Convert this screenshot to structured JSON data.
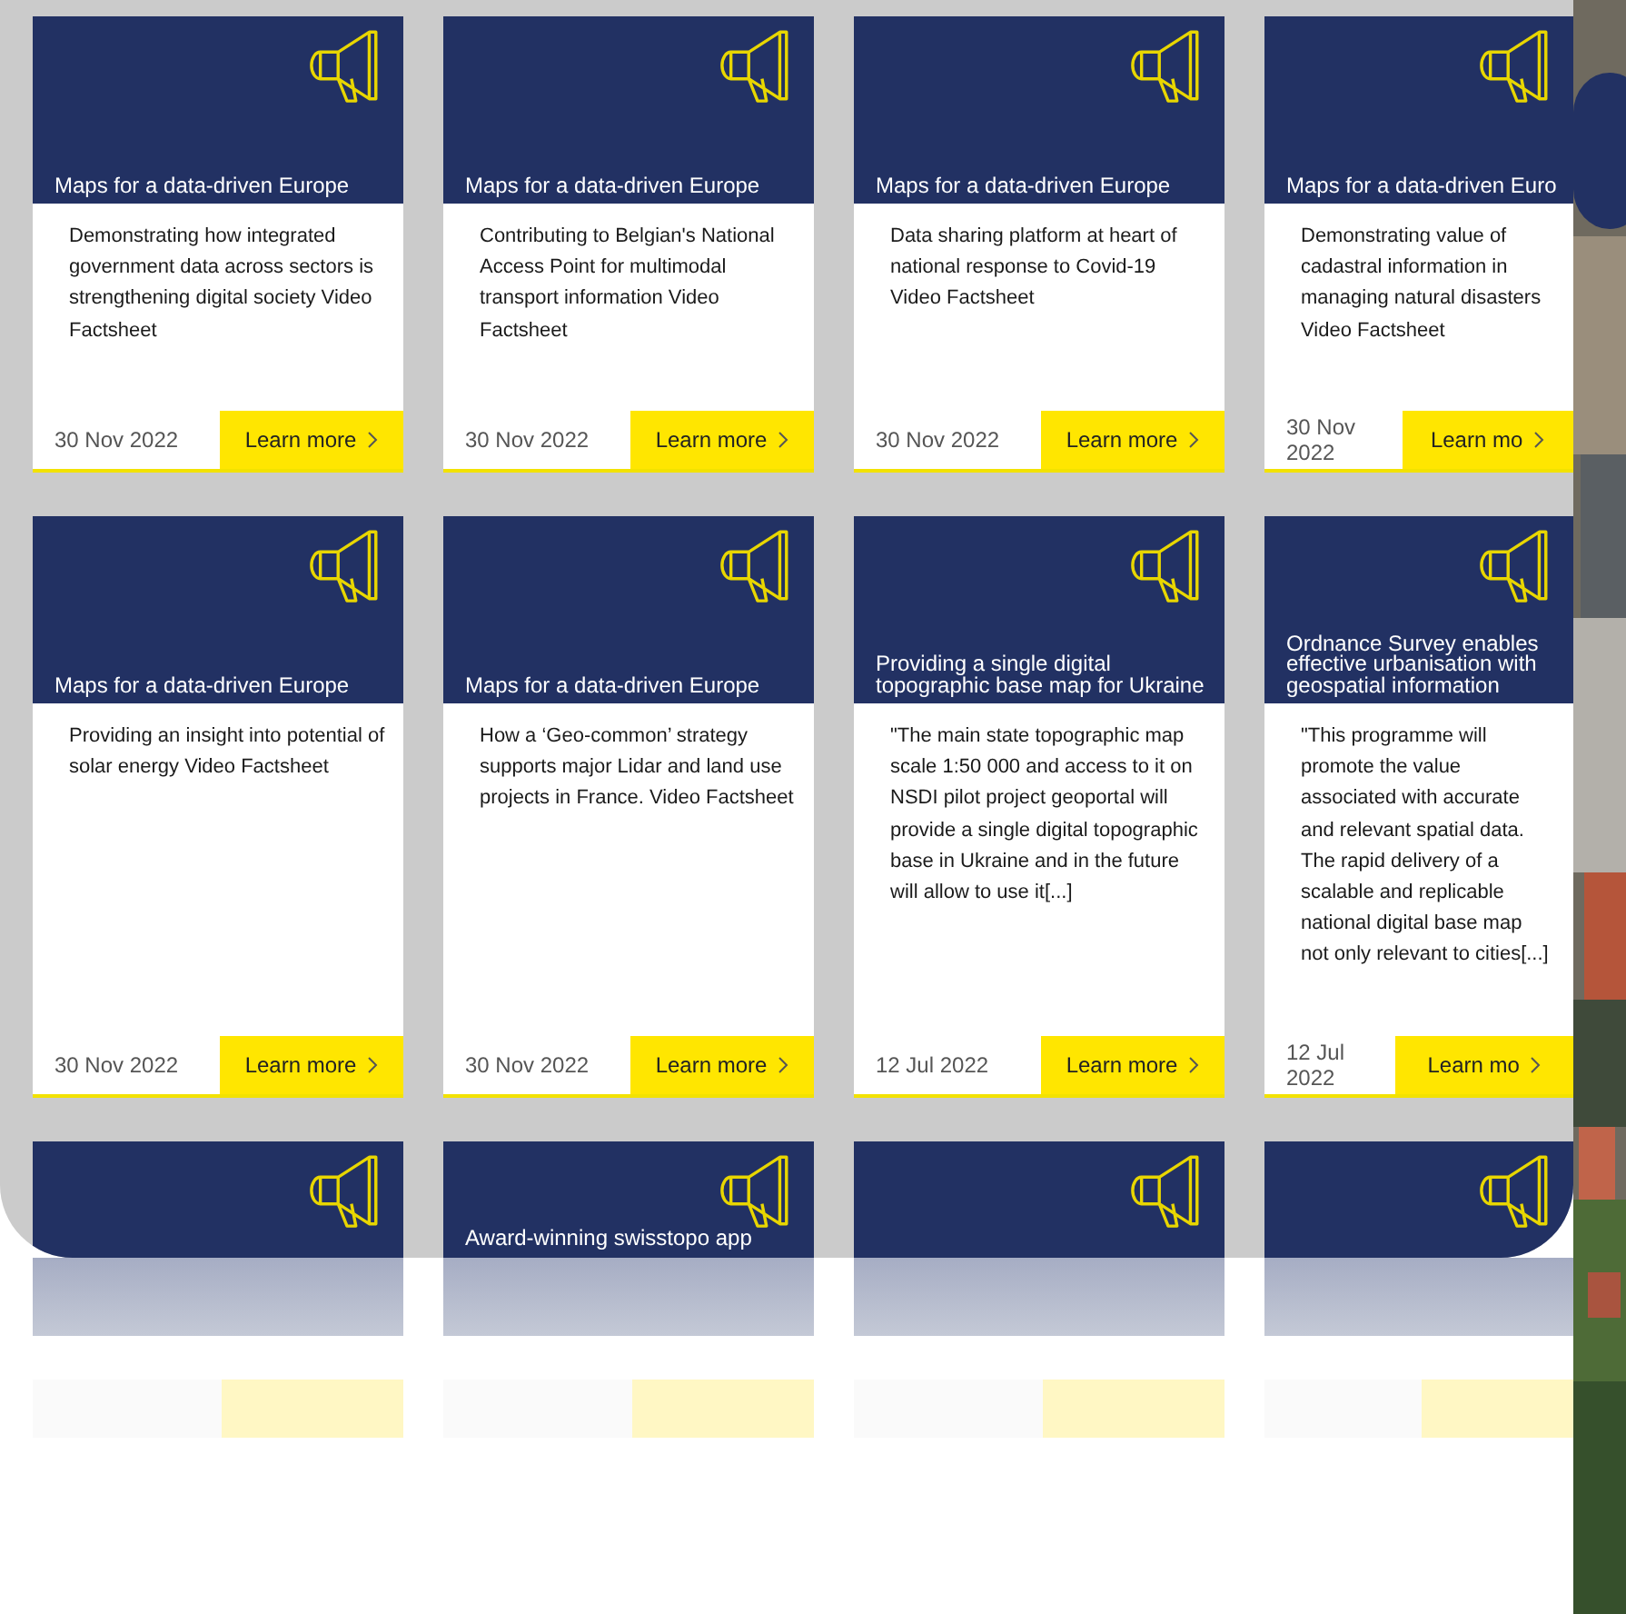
{
  "cards": [
    {
      "title": "Maps for a data-driven Europe",
      "body": "Demonstrating how integrated government data across sectors is strengthening digital society Video Factsheet",
      "date": "30 Nov 2022",
      "button": "Learn more"
    },
    {
      "title": "Maps for a data-driven Europe",
      "body": "Contributing to Belgian's National Access Point for multimodal transport information Video Factsheet",
      "date": "30 Nov 2022",
      "button": "Learn more"
    },
    {
      "title": "Maps for a data-driven Europe",
      "body": "Data sharing platform at heart of national response to Covid-19 Video Factsheet",
      "date": "30 Nov 2022",
      "button": "Learn more"
    },
    {
      "title": "Maps for a data-driven Euro",
      "body": "Demonstrating value of cadastral information in managing natural disasters Video Factsheet",
      "date": "30 Nov 2022",
      "button": "Learn mo"
    },
    {
      "title": "Maps for a data-driven Europe",
      "body": "Providing an insight into potential of solar energy Video Factsheet",
      "date": "30 Nov 2022",
      "button": "Learn more"
    },
    {
      "title": "Maps for a data-driven Europe",
      "body": "How a ‘Geo-common’ strategy supports major Lidar and land use projects in France. Video Factsheet",
      "date": "30 Nov 2022",
      "button": "Learn more"
    },
    {
      "title": "Providing a single digital topographic base map for Ukraine",
      "body": "\"The main state topographic map scale 1:50 000 and access to it on NSDI pilot project geoportal will provide a single digital topographic base in Ukraine and in the future will allow to use it[...]",
      "date": "12 Jul 2022",
      "button": "Learn more"
    },
    {
      "title": "Ordnance Survey enables effective urbanisation with geospatial information",
      "body": "\"This programme will promote the value associated with accurate and relevant spatial data. The rapid delivery of a scalable and replicable national digital base map not only relevant to cities[...]",
      "date": "12 Jul 2022",
      "button": "Learn mo"
    },
    {
      "kind": "cut"
    },
    {
      "kind": "cut",
      "title": "Award-winning swisstopo app"
    },
    {
      "kind": "cut"
    },
    {
      "kind": "cut"
    }
  ]
}
